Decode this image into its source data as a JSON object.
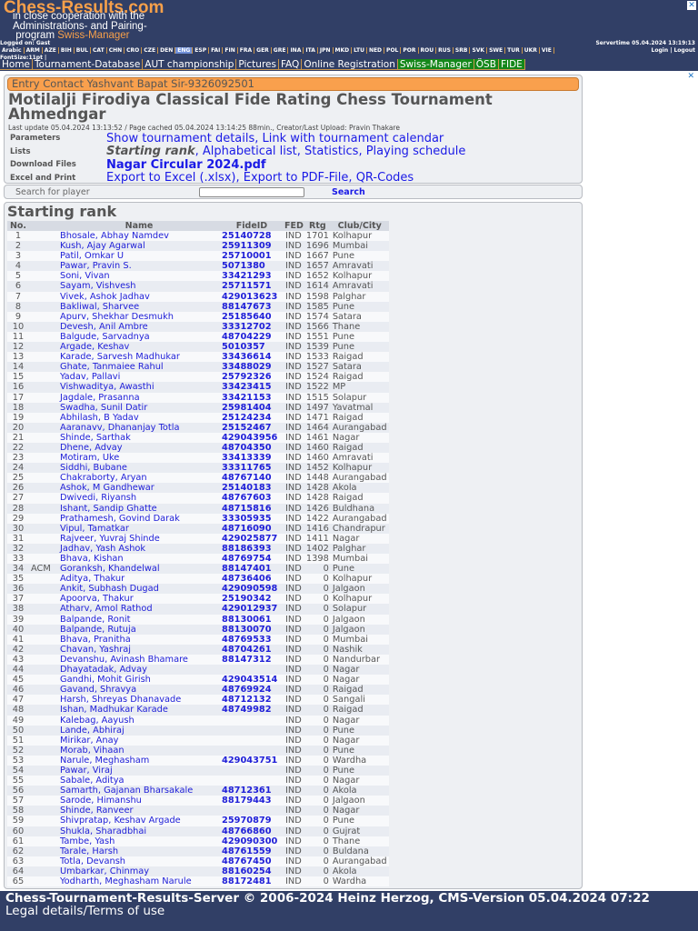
{
  "header": {
    "logo": "Chess-Results.com",
    "tagline1": "in close cooperation with the",
    "tagline2": "Administrations- and Pairing-",
    "tagline3": "program",
    "tagline_brand": "Swiss-Manager",
    "logged_on": "Logged on: Gast",
    "servertime": "Servertime 05.04.2024 13:19:13",
    "languages": [
      "Arabic",
      "ARM",
      "AZE",
      "BIH",
      "BUL",
      "CAT",
      "CHN",
      "CRO",
      "CZE",
      "DEN",
      "ENG",
      "ESP",
      "FAI",
      "FIN",
      "FRA",
      "GER",
      "GRE",
      "INA",
      "ITA",
      "JPN",
      "MKD",
      "LTU",
      "NED",
      "POL",
      "POR",
      "ROU",
      "RUS",
      "SRB",
      "SVK",
      "SWE",
      "TUR",
      "UKR",
      "VIE"
    ],
    "active_language": "ENG",
    "login": "Login",
    "logout": "Logout",
    "fontsize": "FontSize:11pt",
    "nav": [
      "Home",
      "Tournament-Database",
      "AUT championship",
      "Pictures",
      "FAQ",
      "Online Registration",
      "Swiss-Manager",
      "ÖSB",
      "FIDE"
    ]
  },
  "banner": "Entry Contact Yashvant Bapat Sir-9326092501",
  "title": "Motilalji Firodiya Classical Fide Rating Chess Tournament Ahmedngar",
  "last_update": "Last update 05.04.2024 13:13:52 / Page cached 05.04.2024 13:14:25 88min., Creator/Last Upload: Pravin Thakare",
  "params": {
    "parameters_label": "Parameters",
    "parameters": [
      "Show tournament details",
      "Link with tournament calendar"
    ],
    "lists_label": "Lists",
    "lists_current": "Starting rank",
    "lists": [
      "Alphabetical list",
      "Statistics",
      "Playing schedule"
    ],
    "download_label": "Download Files",
    "download": "Nagar Circular 2024.pdf",
    "excel_label": "Excel and Print",
    "excel": [
      "Export to Excel (.xlsx)",
      "Export to PDF-File",
      "QR-Codes"
    ]
  },
  "search": {
    "label": "Search for player",
    "value": "",
    "button": "Search"
  },
  "section_title": "Starting rank",
  "columns": [
    "No.",
    "",
    "Name",
    "FideID",
    "FED",
    "Rtg",
    "Club/City"
  ],
  "rows": [
    [
      "1",
      "",
      "Bhosale, Abhay Namdev",
      "25140728",
      "IND",
      "1701",
      "Kolhapur"
    ],
    [
      "2",
      "",
      "Kush, Ajay Agarwal",
      "25911309",
      "IND",
      "1696",
      "Mumbai"
    ],
    [
      "3",
      "",
      "Patil, Omkar U",
      "25710001",
      "IND",
      "1667",
      "Pune"
    ],
    [
      "4",
      "",
      "Pawar, Pravin S.",
      "5071380",
      "IND",
      "1657",
      "Amravati"
    ],
    [
      "5",
      "",
      "Soni, Vivan",
      "33421293",
      "IND",
      "1652",
      "Kolhapur"
    ],
    [
      "6",
      "",
      "Sayam, Vishvesh",
      "25711571",
      "IND",
      "1614",
      "Amravati"
    ],
    [
      "7",
      "",
      "Vivek, Ashok Jadhav",
      "429013623",
      "IND",
      "1598",
      "Palghar"
    ],
    [
      "8",
      "",
      "Bakliwal, Sharvee",
      "88147673",
      "IND",
      "1585",
      "Pune"
    ],
    [
      "9",
      "",
      "Apurv, Shekhar Desmukh",
      "25185640",
      "IND",
      "1574",
      "Satara"
    ],
    [
      "10",
      "",
      "Devesh, Anil Ambre",
      "33312702",
      "IND",
      "1566",
      "Thane"
    ],
    [
      "11",
      "",
      "Balgude, Sarvadnya",
      "48704229",
      "IND",
      "1551",
      "Pune"
    ],
    [
      "12",
      "",
      "Argade, Keshav",
      "5010357",
      "IND",
      "1539",
      "Pune"
    ],
    [
      "13",
      "",
      "Karade, Sarvesh Madhukar",
      "33436614",
      "IND",
      "1533",
      "Raigad"
    ],
    [
      "14",
      "",
      "Ghate, Tanmaiee Rahul",
      "33488029",
      "IND",
      "1527",
      "Satara"
    ],
    [
      "15",
      "",
      "Yadav, Pallavi",
      "25792326",
      "IND",
      "1524",
      "Raigad"
    ],
    [
      "16",
      "",
      "Vishwaditya, Awasthi",
      "33423415",
      "IND",
      "1522",
      "MP"
    ],
    [
      "17",
      "",
      "Jagdale, Prasanna",
      "33421153",
      "IND",
      "1515",
      "Solapur"
    ],
    [
      "18",
      "",
      "Swadha, Sunil Datir",
      "25981404",
      "IND",
      "1497",
      "Yavatmal"
    ],
    [
      "19",
      "",
      "Abhilash, B Yadav",
      "25124234",
      "IND",
      "1471",
      "Raigad"
    ],
    [
      "20",
      "",
      "Aaranavv, Dhananjay Totla",
      "25152467",
      "IND",
      "1464",
      "Aurangabad"
    ],
    [
      "21",
      "",
      "Shinde, Sarthak",
      "429043956",
      "IND",
      "1461",
      "Nagar"
    ],
    [
      "22",
      "",
      "Dhene, Advay",
      "48704350",
      "IND",
      "1460",
      "Raigad"
    ],
    [
      "23",
      "",
      "Motiram, Uke",
      "33413339",
      "IND",
      "1460",
      "Amravati"
    ],
    [
      "24",
      "",
      "Siddhi, Bubane",
      "33311765",
      "IND",
      "1452",
      "Kolhapur"
    ],
    [
      "25",
      "",
      "Chakraborty, Aryan",
      "48767140",
      "IND",
      "1448",
      "Aurangabad"
    ],
    [
      "26",
      "",
      "Ashok, M Gandhewar",
      "25140183",
      "IND",
      "1428",
      "Akola"
    ],
    [
      "27",
      "",
      "Dwivedi, Riyansh",
      "48767603",
      "IND",
      "1428",
      "Raigad"
    ],
    [
      "28",
      "",
      "Ishant, Sandip Ghatte",
      "48715816",
      "IND",
      "1426",
      "Buldhana"
    ],
    [
      "29",
      "",
      "Prathamesh, Govind Darak",
      "33305935",
      "IND",
      "1422",
      "Aurangabad"
    ],
    [
      "30",
      "",
      "Vipul, Tamatkar",
      "48716090",
      "IND",
      "1416",
      "Chandrapur"
    ],
    [
      "31",
      "",
      "Rajveer, Yuvraj Shinde",
      "429025877",
      "IND",
      "1411",
      "Nagar"
    ],
    [
      "32",
      "",
      "Jadhav, Yash Ashok",
      "88186393",
      "IND",
      "1402",
      "Palghar"
    ],
    [
      "33",
      "",
      "Bhava, Kishan",
      "48769754",
      "IND",
      "1398",
      "Mumbai"
    ],
    [
      "34",
      "ACM",
      "Goranksh, Khandelwal",
      "88147401",
      "IND",
      "0",
      "Pune"
    ],
    [
      "35",
      "",
      "Aditya, Thakur",
      "48736406",
      "IND",
      "0",
      "Kolhapur"
    ],
    [
      "36",
      "",
      "Ankit, Subhash Dugad",
      "429090598",
      "IND",
      "0",
      "Jalgaon"
    ],
    [
      "37",
      "",
      "Apoorva, Thakur",
      "25190342",
      "IND",
      "0",
      "Kolhapur"
    ],
    [
      "38",
      "",
      "Atharv, Amol Rathod",
      "429012937",
      "IND",
      "0",
      "Solapur"
    ],
    [
      "39",
      "",
      "Balpande, Ronit",
      "88130061",
      "IND",
      "0",
      "Jalgaon"
    ],
    [
      "40",
      "",
      "Balpande, Rutuja",
      "88130070",
      "IND",
      "0",
      "Jalgaon"
    ],
    [
      "41",
      "",
      "Bhava, Pranitha",
      "48769533",
      "IND",
      "0",
      "Mumbai"
    ],
    [
      "42",
      "",
      "Chavan, Yashraj",
      "48704261",
      "IND",
      "0",
      "Nashik"
    ],
    [
      "43",
      "",
      "Devanshu, Avinash Bhamare",
      "88147312",
      "IND",
      "0",
      "Nandurbar"
    ],
    [
      "44",
      "",
      "Dhayatadak, Advay",
      "",
      "IND",
      "0",
      "Nagar"
    ],
    [
      "45",
      "",
      "Gandhi, Mohit Girish",
      "429043514",
      "IND",
      "0",
      "Nagar"
    ],
    [
      "46",
      "",
      "Gavand, Shravya",
      "48769924",
      "IND",
      "0",
      "Raigad"
    ],
    [
      "47",
      "",
      "Harsh, Shreyas Dhanavade",
      "48712132",
      "IND",
      "0",
      "Sangali"
    ],
    [
      "48",
      "",
      "Ishan, Madhukar Karade",
      "48749982",
      "IND",
      "0",
      "Raigad"
    ],
    [
      "49",
      "",
      "Kalebag, Aayush",
      "",
      "IND",
      "0",
      "Nagar"
    ],
    [
      "50",
      "",
      "Lande, Abhiraj",
      "",
      "IND",
      "0",
      "Pune"
    ],
    [
      "51",
      "",
      "Mirikar, Anay",
      "",
      "IND",
      "0",
      "Nagar"
    ],
    [
      "52",
      "",
      "Morab, Vihaan",
      "",
      "IND",
      "0",
      "Pune"
    ],
    [
      "53",
      "",
      "Narule, Meghasham",
      "429043751",
      "IND",
      "0",
      "Wardha"
    ],
    [
      "54",
      "",
      "Pawar, Viraj",
      "",
      "IND",
      "0",
      "Pune"
    ],
    [
      "55",
      "",
      "Sabale, Aditya",
      "",
      "IND",
      "0",
      "Nagar"
    ],
    [
      "56",
      "",
      "Samarth, Gajanan Bharsakale",
      "48712361",
      "IND",
      "0",
      "Akola"
    ],
    [
      "57",
      "",
      "Sarode, Himanshu",
      "88179443",
      "IND",
      "0",
      "Jalgaon"
    ],
    [
      "58",
      "",
      "Shinde, Ranveer",
      "",
      "IND",
      "0",
      "Nagar"
    ],
    [
      "59",
      "",
      "Shivpratap, Keshav Argade",
      "25970879",
      "IND",
      "0",
      "Pune"
    ],
    [
      "60",
      "",
      "Shukla, Sharadbhai",
      "48766860",
      "IND",
      "0",
      "Gujrat"
    ],
    [
      "61",
      "",
      "Tambe, Yash",
      "429090300",
      "IND",
      "0",
      "Thane"
    ],
    [
      "62",
      "",
      "Tarale, Harsh",
      "48761559",
      "IND",
      "0",
      "Buldana"
    ],
    [
      "63",
      "",
      "Totla, Devansh",
      "48767450",
      "IND",
      "0",
      "Aurangabad"
    ],
    [
      "64",
      "",
      "Umbarkar, Chinmay",
      "88160254",
      "IND",
      "0",
      "Akola"
    ],
    [
      "65",
      "",
      "Yodharth, Meghasham Narule",
      "88172481",
      "IND",
      "0",
      "Wardha"
    ]
  ],
  "footer": {
    "line1": "Chess-Tournament-Results-Server © 2006-2024 Heinz Herzog, CMS-Version 05.04.2024 07:22",
    "legal": "Legal details/Terms of use"
  }
}
